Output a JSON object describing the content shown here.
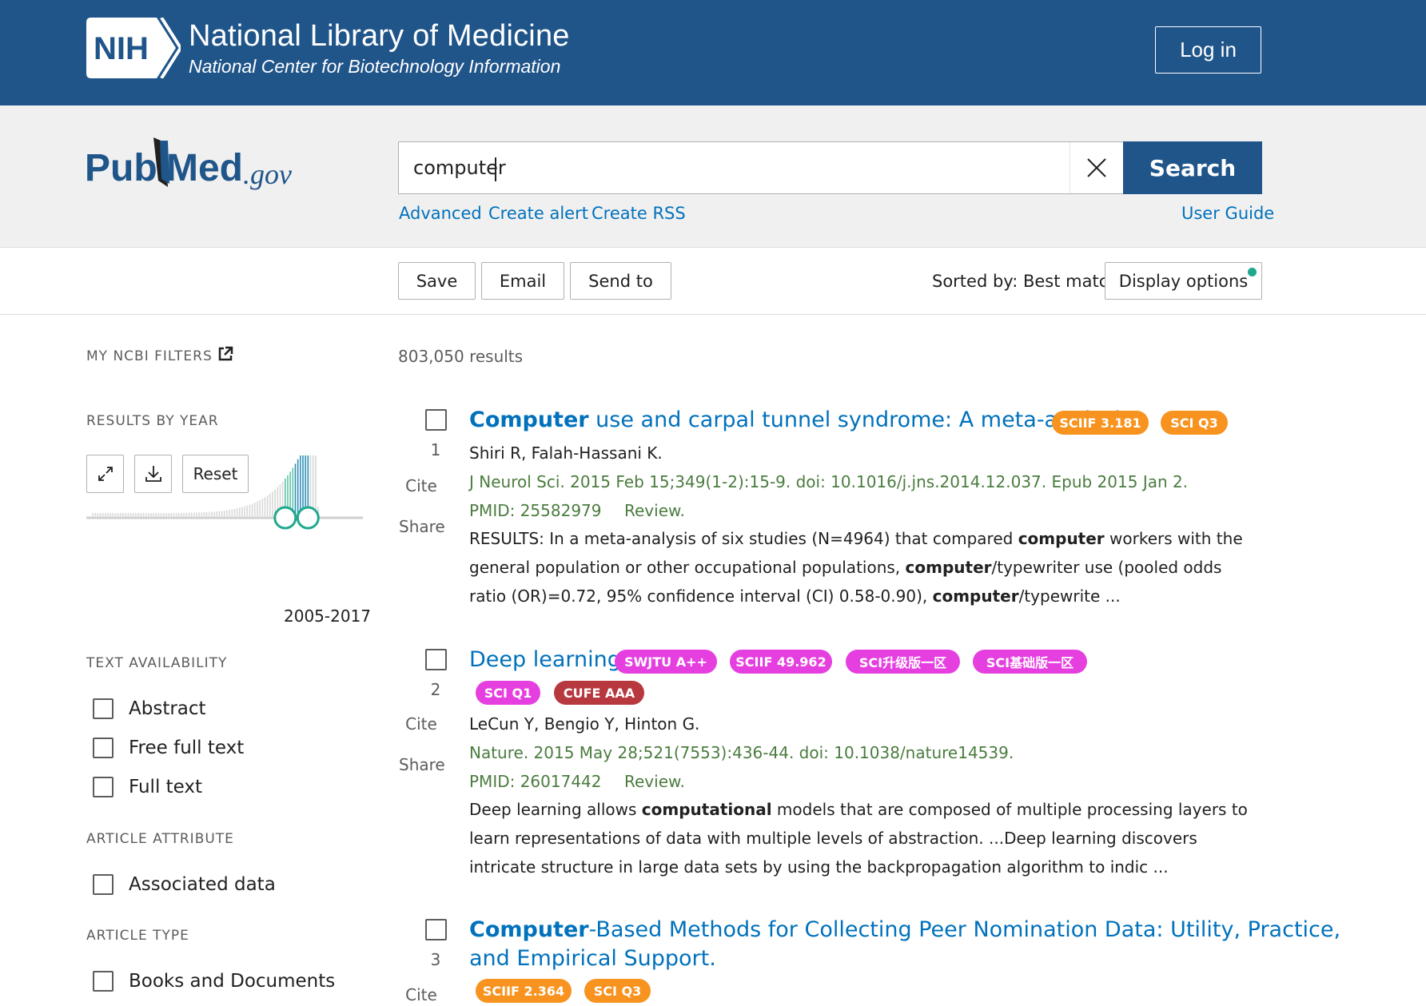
{
  "header": {
    "logo_text": "NIH",
    "title": "National Library of Medicine",
    "subtitle": "National Center for Biotechnology Information",
    "login_label": "Log in"
  },
  "search": {
    "logo_text": "PubMed",
    "logo_suffix": ".gov",
    "query": "computer",
    "button_label": "Search",
    "links": {
      "advanced": "Advanced",
      "create_alert": "Create alert",
      "create_rss": "Create RSS",
      "user_guide": "User Guide"
    }
  },
  "toolbar": {
    "save": "Save",
    "email": "Email",
    "send_to": "Send to",
    "sorted_by": "Sorted by: Best match",
    "display_options": "Display options",
    "colors": {
      "accent": "#20558a",
      "link": "#0071bc",
      "citation": "#4a7c3f",
      "dot": "#20a88e"
    }
  },
  "sidebar": {
    "my_ncbi_filters": "MY NCBI FILTERS",
    "results_by_year": "RESULTS BY YEAR",
    "reset": "Reset",
    "year_range": "2005-2017",
    "text_availability": {
      "heading": "TEXT AVAILABILITY",
      "options": [
        "Abstract",
        "Free full text",
        "Full text"
      ]
    },
    "article_attribute": {
      "heading": "ARTICLE ATTRIBUTE",
      "options": [
        "Associated data"
      ]
    },
    "article_type": {
      "heading": "ARTICLE TYPE",
      "options": [
        "Books and Documents"
      ]
    }
  },
  "results": {
    "count": "803,050 results",
    "cite_label": "Cite",
    "share_label": "Share",
    "items": [
      {
        "number": "1",
        "title_bold": "Computer",
        "title_rest": " use and carpal tunnel syndrome: A meta-analysis.",
        "badges": [
          {
            "text": "SCIIF 3.181",
            "color": "#f7931e"
          },
          {
            "text": "SCI Q3",
            "color": "#f7931e"
          }
        ],
        "authors": "Shiri R, Falah-Hassani K.",
        "citation": "J Neurol Sci. 2015 Feb 15;349(1-2):15-9. doi: 10.1016/j.jns.2014.12.037. Epub 2015 Jan 2.",
        "pmid": "PMID: 25582979",
        "type": "Review.",
        "snippet": [
          {
            "t": "RESULTS: In a meta-analysis of six studies (N=4964) that compared ",
            "b": false
          },
          {
            "t": "computer",
            "b": true
          },
          {
            "t": " workers with the general population or other occupational populations, ",
            "b": false
          },
          {
            "t": "computer",
            "b": true
          },
          {
            "t": "/typewriter use (pooled odds ratio (OR)=0.72, 95% confidence interval (CI) 0.58-0.90), ",
            "b": false
          },
          {
            "t": "computer",
            "b": true
          },
          {
            "t": "/typewrite ...",
            "b": false
          }
        ]
      },
      {
        "number": "2",
        "title_bold": "",
        "title_rest": "Deep learning.",
        "badges": [
          {
            "text": "SWJTU A++",
            "color": "#e63fe0"
          },
          {
            "text": "SCIIF 49.962",
            "color": "#e63fe0"
          },
          {
            "text": "SCI升级版一区",
            "color": "#e63fe0"
          },
          {
            "text": "SCI基础版一区",
            "color": "#e63fe0"
          },
          {
            "text": "SCI Q1",
            "color": "#e63fe0"
          },
          {
            "text": "CUFE AAA",
            "color": "#b7393f"
          }
        ],
        "authors": "LeCun Y, Bengio Y, Hinton G.",
        "citation": "Nature. 2015 May 28;521(7553):436-44. doi: 10.1038/nature14539.",
        "pmid": "PMID: 26017442",
        "type": "Review.",
        "snippet": [
          {
            "t": "Deep learning allows ",
            "b": false
          },
          {
            "t": "computational",
            "b": true
          },
          {
            "t": " models that are composed of multiple processing layers to learn representations of data with multiple levels of abstraction. ...Deep learning discovers intricate structure in large data sets by using the backpropagation algorithm to indic ...",
            "b": false
          }
        ]
      },
      {
        "number": "3",
        "title_bold": "Computer",
        "title_rest": "-Based Methods for Collecting Peer Nomination Data: Utility, Practice,",
        "title_line2": "and Empirical Support.",
        "badges": [
          {
            "text": "SCIIF 2.364",
            "color": "#f7931e"
          },
          {
            "text": "SCI Q3",
            "color": "#f7931e"
          }
        ]
      }
    ]
  }
}
